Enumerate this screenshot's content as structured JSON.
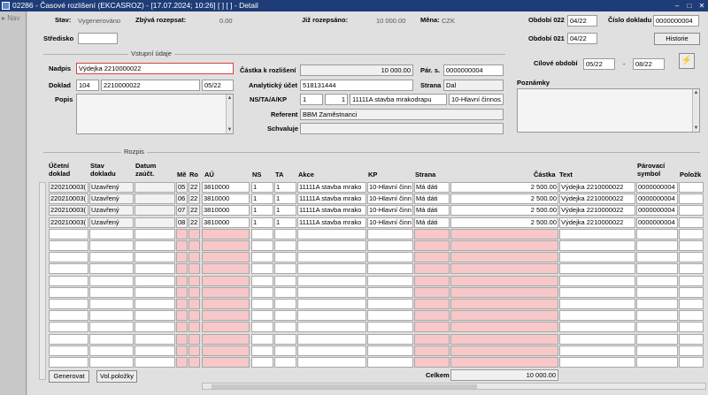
{
  "window": {
    "title": "02286 - Časové rozlišení (EKCASROZ) - [17.07.2024; 10:26]  [ ]  [ ] - Detail"
  },
  "nav": {
    "label": "Nav"
  },
  "header": {
    "stav_label": "Stav:",
    "stav_value": "Vygenerováno",
    "zbyva_label": "Zbývá rozepsat:",
    "zbyva_value": "0.00",
    "jiz_label": "Již rozepsáno:",
    "jiz_value": "10 000.00",
    "mena_label": "Měna:",
    "mena_value": "CZK",
    "obdobi022_label": "Období 022",
    "obdobi022_value": "04/22",
    "cislo_label": "Číslo dokladu",
    "cislo_value": "0000000004",
    "obdobi021_label": "Období 021",
    "obdobi021_value": "04/22",
    "historie_label": "Historie",
    "stredisko_label": "Středisko",
    "stredisko_value": ""
  },
  "vstup": {
    "section_title": "Vstupní údaje",
    "nadpis_label": "Nadpis",
    "nadpis_value": "Výdejka 2210000022",
    "doklad_label": "Doklad",
    "doklad_a": "104",
    "doklad_b": "2210000022",
    "doklad_c": "05/22",
    "popis_label": "Popis",
    "popis_value": "",
    "castka_label": "Částka k rozlišení",
    "castka_value": "10 000.00",
    "par_label": "Pár. s.",
    "par_value": "0000000004",
    "analyt_label": "Analytický účet",
    "analyt_value": "518131444",
    "strana_label": "Strana",
    "strana_value": "Dal",
    "ns_label": "NS/TA/A/KP",
    "ns_a": "1",
    "ns_b": "1",
    "ns_c": "11111A stavba mrakodrapu",
    "ns_d": "10-Hlavní činnos",
    "referent_label": "Referent",
    "referent_value": "BBM Zaměstnanci",
    "schvaluje_label": "Schvaluje",
    "schvaluje_value": "",
    "cilove_label": "Cílové období",
    "cilove_from": "05/22",
    "cilove_dash": "-",
    "cilove_to": "08/22",
    "poznamky_label": "Poznámky",
    "poznamky_value": ""
  },
  "rozpis": {
    "section_title": "Rozpis",
    "columns": {
      "ucetni": "Účetní doklad",
      "stav": "Stav dokladu",
      "datum": "Datum zaúčt.",
      "me": "Mě",
      "ro": "Ro",
      "au": "AÚ",
      "ns": "NS",
      "ta": "TA",
      "akce": "Akce",
      "kp": "KP",
      "strana": "Strana",
      "castka": "Částka",
      "text": "Text",
      "parovaci": "Párovací symbol",
      "polozky": "Položk"
    },
    "rows": [
      {
        "ucetni": "220210003(",
        "stav": "Uzavřený",
        "datum": "",
        "me": "05",
        "ro": "22",
        "au": "3810000",
        "ns": "1",
        "ta": "1",
        "akce": "11111A stavba mrako",
        "kp": "10-Hlavní činn",
        "strana": "Má dáti",
        "castka": "2 500.00",
        "text": "Výdejka 2210000022",
        "parovaci": "0000000004"
      },
      {
        "ucetni": "220210003(",
        "stav": "Uzavřený",
        "datum": "",
        "me": "06",
        "ro": "22",
        "au": "3810000",
        "ns": "1",
        "ta": "1",
        "akce": "11111A stavba mrako",
        "kp": "10-Hlavní činn",
        "strana": "Má dáti",
        "castka": "2 500.00",
        "text": "Výdejka 2210000022",
        "parovaci": "0000000004"
      },
      {
        "ucetni": "220210003(",
        "stav": "Uzavřený",
        "datum": "",
        "me": "07",
        "ro": "22",
        "au": "3810000",
        "ns": "1",
        "ta": "1",
        "akce": "11111A stavba mrako",
        "kp": "10-Hlavní činn",
        "strana": "Má dáti",
        "castka": "2 500.00",
        "text": "Výdejka 2210000022",
        "parovaci": "0000000004"
      },
      {
        "ucetni": "220210003(",
        "stav": "Uzavřený",
        "datum": "",
        "me": "08",
        "ro": "22",
        "au": "3810000",
        "ns": "1",
        "ta": "1",
        "akce": "11111A stavba mrako",
        "kp": "10-Hlavní činn",
        "strana": "Má dáti",
        "castka": "2 500.00",
        "text": "Výdejka 2210000022",
        "parovaci": "0000000004"
      }
    ],
    "empty_row_count": 12
  },
  "footer": {
    "generovat_label": "Generovat",
    "volpolozky_label": "Vol.položky",
    "celkem_label": "Celkem",
    "celkem_value": "10 000.00"
  }
}
